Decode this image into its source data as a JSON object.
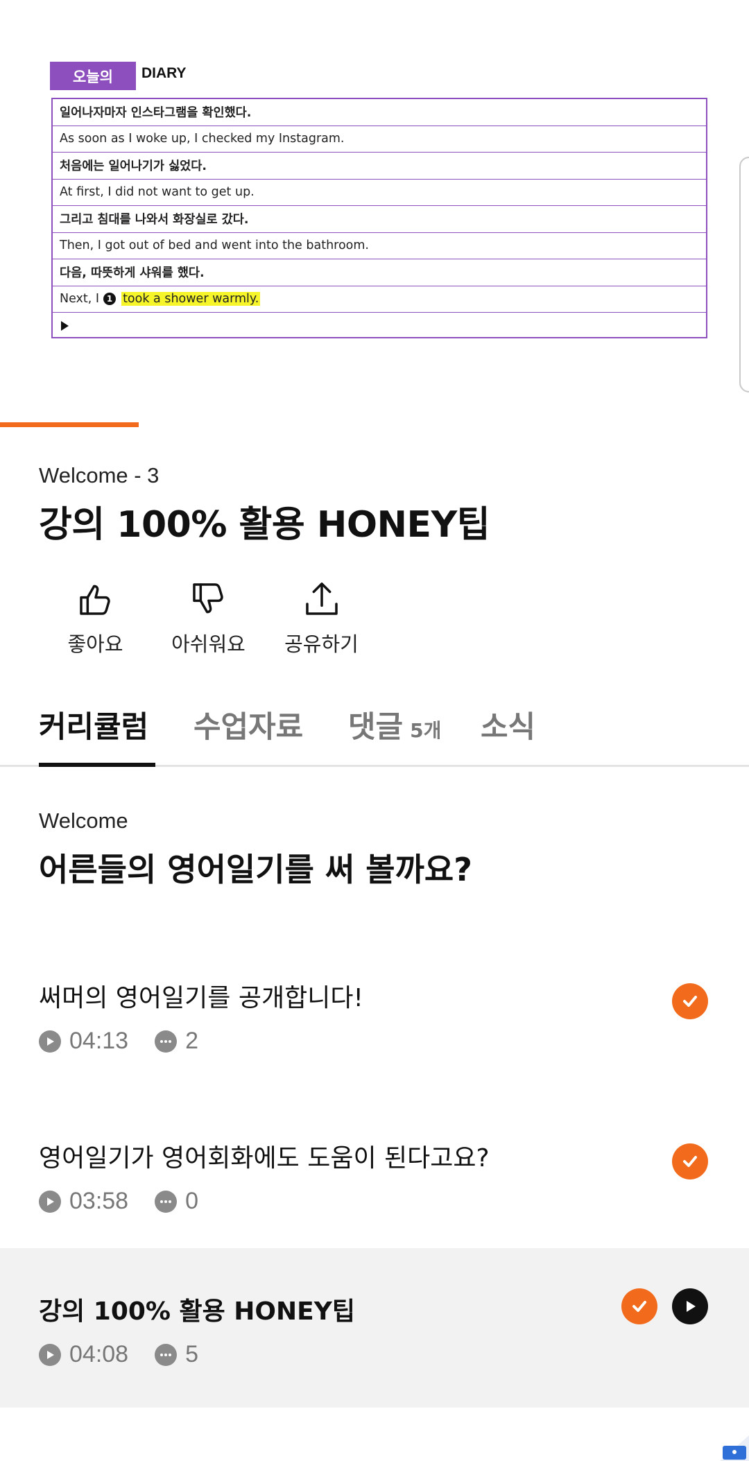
{
  "video": {
    "diary_badge": "오늘의",
    "diary_title": "DIARY",
    "rows": [
      {
        "text": "일어나자마자 인스타그램을 확인했다.",
        "lang": "ko"
      },
      {
        "text": "As soon as I woke up, I checked my Instagram.",
        "lang": "en"
      },
      {
        "text": "처음에는 일어나기가 싫었다.",
        "lang": "ko"
      },
      {
        "text": "At first, I did not want to get up.",
        "lang": "en"
      },
      {
        "text": "그리고 침대를 나와서 화장실로 갔다.",
        "lang": "ko"
      },
      {
        "text": "Then, I got out of bed and went into the bathroom.",
        "lang": "en"
      },
      {
        "text": "다음, 따뜻하게 샤워를 했다.",
        "lang": "ko"
      }
    ],
    "last_row": {
      "prefix": "Next, I",
      "number": "1",
      "highlight": "took a shower warmly."
    },
    "progress": 0.185
  },
  "header": {
    "subtitle": "Welcome - 3",
    "title": "강의 100% 활용 HONEY팁"
  },
  "actions": [
    {
      "icon": "thumbs-up-icon",
      "label": "좋아요"
    },
    {
      "icon": "thumbs-down-icon",
      "label": "아쉬워요"
    },
    {
      "icon": "share-icon",
      "label": "공유하기"
    }
  ],
  "tabs": [
    {
      "label": "커리큘럼",
      "active": true
    },
    {
      "label": "수업자료",
      "active": false
    },
    {
      "label": "댓글",
      "count": "5개",
      "active": false
    },
    {
      "label": "소식",
      "active": false
    }
  ],
  "curriculum": {
    "section_sub": "Welcome",
    "section_title": "어른들의 영어일기를 써 볼까요?",
    "lessons": [
      {
        "title": "써머의 영어일기를 공개합니다!",
        "duration": "04:13",
        "comments": "2",
        "completed": true,
        "current": false
      },
      {
        "title": "영어일기가 영어회화에도 도움이 된다고요?",
        "duration": "03:58",
        "comments": "0",
        "completed": true,
        "current": false
      },
      {
        "title": "강의 100% 활용 HONEY팁",
        "duration": "04:08",
        "comments": "5",
        "completed": true,
        "current": true
      }
    ]
  },
  "colors": {
    "accent": "#f26b1d",
    "diary_purple": "#8c4fbd",
    "highlight": "#f6f52a"
  }
}
